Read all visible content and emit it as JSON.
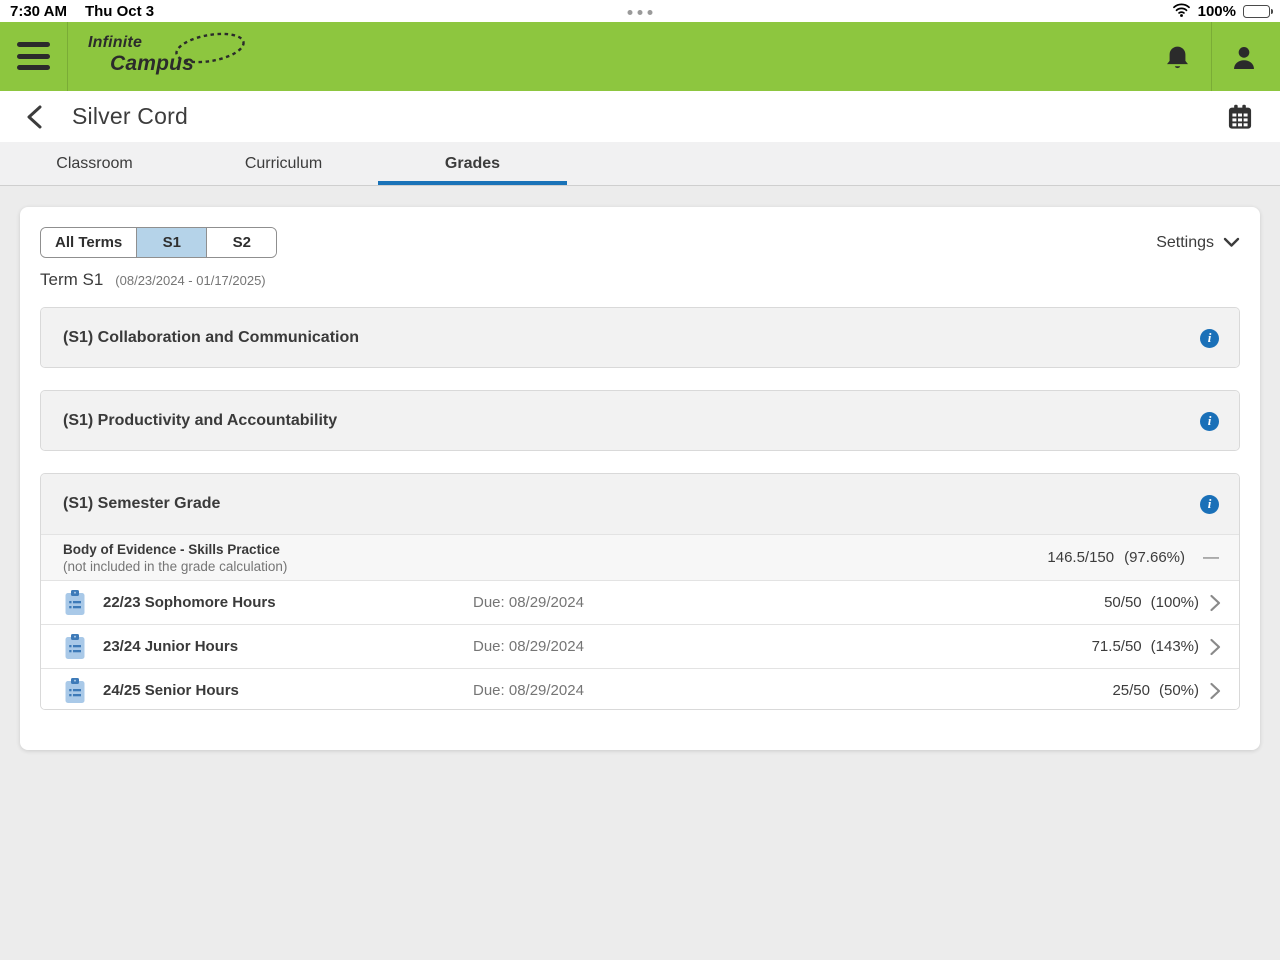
{
  "status_bar": {
    "time": "7:30 AM",
    "date": "Thu Oct 3",
    "battery_percent": "100%"
  },
  "app_header": {
    "logo_line1": "Infinite",
    "logo_line2": "Campus"
  },
  "title_bar": {
    "title": "Silver Cord"
  },
  "tabs": [
    {
      "label": "Classroom",
      "active": false
    },
    {
      "label": "Curriculum",
      "active": false
    },
    {
      "label": "Grades",
      "active": true
    }
  ],
  "toolbar": {
    "segments": [
      {
        "label": "All Terms",
        "selected": false
      },
      {
        "label": "S1",
        "selected": true
      },
      {
        "label": "S2",
        "selected": false
      }
    ],
    "settings_label": "Settings"
  },
  "term": {
    "label": "Term S1",
    "range": "(08/23/2024 - 01/17/2025)"
  },
  "sections": [
    {
      "title": "(S1) Collaboration and Communication"
    },
    {
      "title": "(S1) Productivity and Accountability"
    },
    {
      "title": "(S1) Semester Grade",
      "category": {
        "name": "Body of Evidence - Skills Practice",
        "note": "(not included in the grade calculation)",
        "score": "146.5/150",
        "percent": "(97.66%)",
        "dash": "—"
      },
      "assignments": [
        {
          "name": "22/23 Sophomore Hours",
          "due": "Due: 08/29/2024",
          "score": "50/50",
          "percent": "(100%)"
        },
        {
          "name": "23/24 Junior Hours",
          "due": "Due: 08/29/2024",
          "score": "71.5/50",
          "percent": "(143%)"
        },
        {
          "name": "24/25 Senior Hours",
          "due": "Due: 08/29/2024",
          "score": "25/50",
          "percent": "(50%)"
        }
      ]
    }
  ],
  "colors": {
    "brand_green": "#8dc63f",
    "accent_blue": "#1a73b8",
    "selected_segment": "#b5d3e9",
    "page_background": "#ececec"
  }
}
